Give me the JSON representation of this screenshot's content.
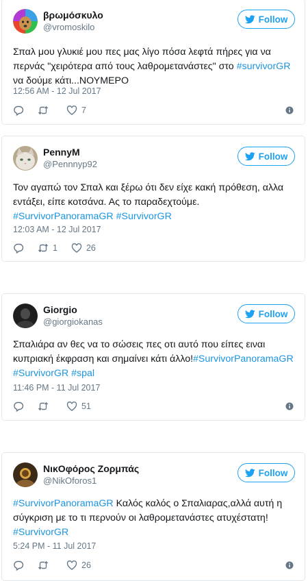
{
  "follow_label": "Follow",
  "tweets": [
    {
      "display_name": "βρωμόσκυλο",
      "username": "@vromoskilo",
      "text_pre": "Σπαλ μου γλυκιέ μου πες μας λίγο πόσα λεφτά πήρες για να περνάς \"χειρότερα από τους λαθρομετανάστες\" στο ",
      "tag1": "#survivorGR",
      "text_post": " να δούμε κάτι...ΝΟΥΜΕΡΟ",
      "timestamp": "12:56 AM - 12 Jul 2017",
      "retweets": "",
      "likes": "7"
    },
    {
      "display_name": "PennyM",
      "username": "@Pennnyp92",
      "text_pre": "Τον αγαπώ τον Σπαλ και ξέρω ότι δεν είχε κακή πρόθεση, αλλα εντάξει, είπε κοτσάνα. Ας το παραδεχτούμε.",
      "tag1": "#SurvivorPanoramaGR",
      "tag2": "#SurvivorGR",
      "timestamp": "12:03 AM - 12 Jul 2017",
      "retweets": "1",
      "likes": "26"
    },
    {
      "display_name": "Giorgio",
      "username": "@giorgiokanas",
      "text_pre": "Σπαλιάρα αν θες να το σώσεις πες οτι αυτό που είπες ειναι κυπριακή έκφραση και σημαίνει κάτι άλλο!",
      "tag1": "#SurvivorPanoramaGR",
      "tag2": "#SurvivorGR",
      "tag3": "#spal",
      "timestamp": "11:46 PM - 11 Jul 2017",
      "retweets": "",
      "likes": "51"
    },
    {
      "display_name": "ΝικΟφόρος Ζορμπάς",
      "username": "@NikOforos1",
      "tag1": "#SurvivorPanoramaGR",
      "text_mid": " Καλός καλός ο Σπαλιαρας,αλλά αυτή η σύγκριση με το τι περνούν οι λαθρομετανάστες ατυχέστατη!",
      "tag2": "#SurvivorGR",
      "timestamp": "5:24 PM - 11 Jul 2017",
      "retweets": "",
      "likes": "26"
    }
  ],
  "icons": {
    "reply": "reply-icon",
    "retweet": "retweet-icon",
    "like": "heart-icon",
    "info": "info-icon",
    "bird": "twitter-bird-icon"
  },
  "colors": {
    "accent": "#1da1f2",
    "hashtag": "#1b95e0",
    "muted": "#657786",
    "border": "#e1e8ed"
  }
}
